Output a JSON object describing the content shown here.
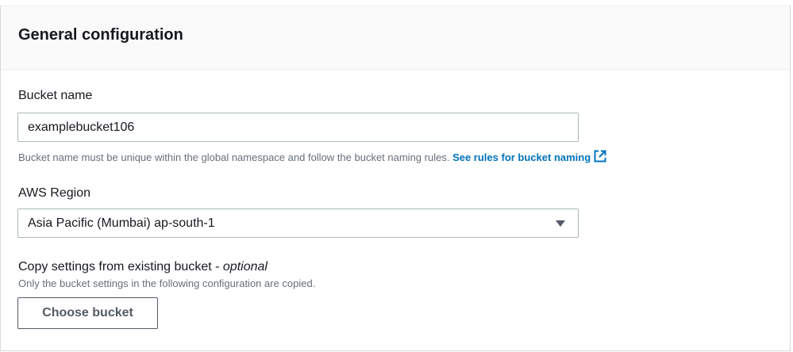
{
  "panel": {
    "title": "General configuration"
  },
  "bucket_name": {
    "label": "Bucket name",
    "value": "examplebucket106",
    "hint": "Bucket name must be unique within the global namespace and follow the bucket naming rules.",
    "link_label": "See rules for bucket naming",
    "link_icon": "external-link-icon"
  },
  "region": {
    "label": "AWS Region",
    "selected": "Asia Pacific (Mumbai) ap-south-1",
    "icon": "caret-down-icon"
  },
  "copy_settings": {
    "label": "Copy settings from existing bucket - ",
    "optional": "optional",
    "hint": "Only the bucket settings in the following configuration are copied.",
    "button_label": "Choose bucket"
  },
  "colors": {
    "link": "#0073bb",
    "header_bg": "#fafafa",
    "border": "#aab7b8",
    "hint_text": "#687078"
  }
}
